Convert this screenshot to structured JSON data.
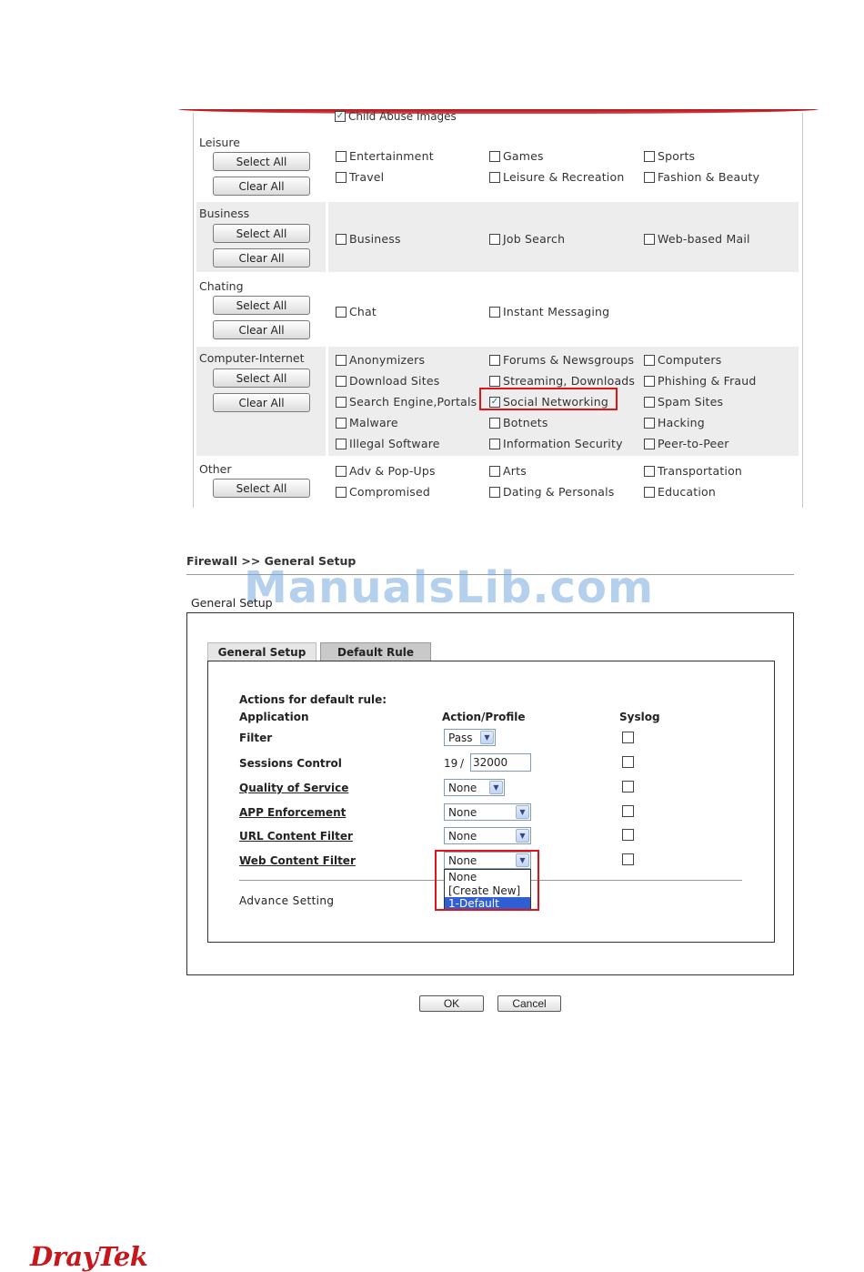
{
  "category_filter": {
    "top_partial_item": {
      "label": "Child Abuse Images",
      "checked": true
    },
    "categories": [
      {
        "name": "Leisure",
        "select_all": "Select All",
        "clear_all": "Clear All",
        "options": [
          {
            "label": "Entertainment",
            "checked": false
          },
          {
            "label": "Games",
            "checked": false
          },
          {
            "label": "Sports",
            "checked": false
          },
          {
            "label": "Travel",
            "checked": false
          },
          {
            "label": "Leisure & Recreation",
            "checked": false
          },
          {
            "label": "Fashion & Beauty",
            "checked": false
          }
        ]
      },
      {
        "name": "Business",
        "select_all": "Select All",
        "clear_all": "Clear All",
        "options": [
          {
            "label": "Business",
            "checked": false
          },
          {
            "label": "Job Search",
            "checked": false
          },
          {
            "label": "Web-based Mail",
            "checked": false
          }
        ]
      },
      {
        "name": "Chating",
        "select_all": "Select All",
        "clear_all": "Clear All",
        "options": [
          {
            "label": "Chat",
            "checked": false
          },
          {
            "label": "Instant Messaging",
            "checked": false
          }
        ]
      },
      {
        "name": "Computer-Internet",
        "select_all": "Select All",
        "clear_all": "Clear All",
        "options": [
          {
            "label": "Anonymizers",
            "checked": false
          },
          {
            "label": "Forums & Newsgroups",
            "checked": false
          },
          {
            "label": "Computers",
            "checked": false
          },
          {
            "label": "Download Sites",
            "checked": false
          },
          {
            "label": "Streaming, Downloads",
            "checked": false
          },
          {
            "label": "Phishing & Fraud",
            "checked": false
          },
          {
            "label": "Search Engine,Portals",
            "checked": false
          },
          {
            "label": "Social Networking",
            "checked": true
          },
          {
            "label": "Spam Sites",
            "checked": false
          },
          {
            "label": "Malware",
            "checked": false
          },
          {
            "label": "Botnets",
            "checked": false
          },
          {
            "label": "Hacking",
            "checked": false
          },
          {
            "label": "Illegal Software",
            "checked": false
          },
          {
            "label": "Information Security",
            "checked": false
          },
          {
            "label": "Peer-to-Peer",
            "checked": false
          }
        ]
      },
      {
        "name": "Other",
        "select_all": "Select All",
        "options": [
          {
            "label": "Adv & Pop-Ups",
            "checked": false
          },
          {
            "label": "Arts",
            "checked": false
          },
          {
            "label": "Transportation",
            "checked": false
          },
          {
            "label": "Compromised",
            "checked": false
          },
          {
            "label": "Dating & Personals",
            "checked": false
          },
          {
            "label": "Education",
            "checked": false
          }
        ]
      }
    ]
  },
  "firewall": {
    "breadcrumb": "Firewall >> General Setup",
    "watermark": "ManualsLib.com",
    "section_title": "General Setup",
    "tabs": [
      {
        "label": "General Setup",
        "active": false
      },
      {
        "label": "Default Rule",
        "active": true
      }
    ],
    "actions_heading": "Actions for default rule:",
    "headers": {
      "application": "Application",
      "action_profile": "Action/Profile",
      "syslog": "Syslog"
    },
    "rows": [
      {
        "label": "Filter",
        "control": "select",
        "value": "Pass",
        "link": false,
        "syslog": false
      },
      {
        "label": "Sessions Control",
        "control": "sessions",
        "current": "19",
        "separator": "/",
        "value": "32000",
        "link": false,
        "syslog": false
      },
      {
        "label": "Quality of Service",
        "control": "select",
        "value": "None",
        "link": true,
        "syslog": false
      },
      {
        "label": "APP Enforcement",
        "control": "select",
        "value": "None",
        "link": true,
        "syslog": false
      },
      {
        "label": "URL Content Filter",
        "control": "select",
        "value": "None",
        "link": true,
        "syslog": false
      },
      {
        "label": "Web Content Filter",
        "control": "select",
        "value": "None",
        "link": true,
        "syslog": false
      }
    ],
    "web_filter_dropdown_options": [
      "None",
      "[Create New]",
      "1-Default"
    ],
    "web_filter_dropdown_highlighted": "1-Default",
    "advance_setting": "Advance Setting",
    "ok_label": "OK",
    "cancel_label": "Cancel"
  },
  "brand": {
    "logo_text": "DrayTek",
    "accent_color": "#c8161d",
    "highlight_color": "#e0141b"
  }
}
